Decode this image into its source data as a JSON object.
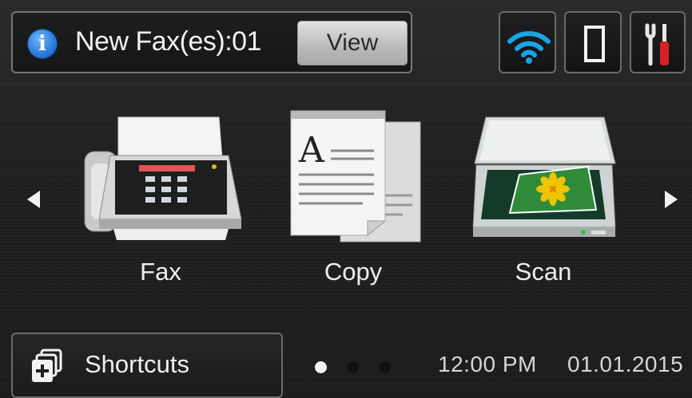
{
  "notification": {
    "text": "New Fax(es):01",
    "view_button_label": "View",
    "icon": "info-icon"
  },
  "status_icons": [
    {
      "name": "wifi-icon"
    },
    {
      "name": "toner-icon"
    },
    {
      "name": "settings-tools-icon"
    }
  ],
  "apps": [
    {
      "label": "Fax",
      "icon": "fax-machine-icon"
    },
    {
      "label": "Copy",
      "icon": "copy-document-icon"
    },
    {
      "label": "Scan",
      "icon": "scanner-icon"
    }
  ],
  "shortcuts": {
    "label": "Shortcuts",
    "icon": "add-shortcut-icon"
  },
  "page_indicator": {
    "total": 3,
    "active": 1
  },
  "status_bar": {
    "time": "12:00 PM",
    "date": "01.01.2015"
  },
  "colors": {
    "background": "#1d1d1d",
    "wifi_blue": "#1aa3e8",
    "info_blue": "#1f6fd1",
    "tool_red": "#d82020"
  }
}
